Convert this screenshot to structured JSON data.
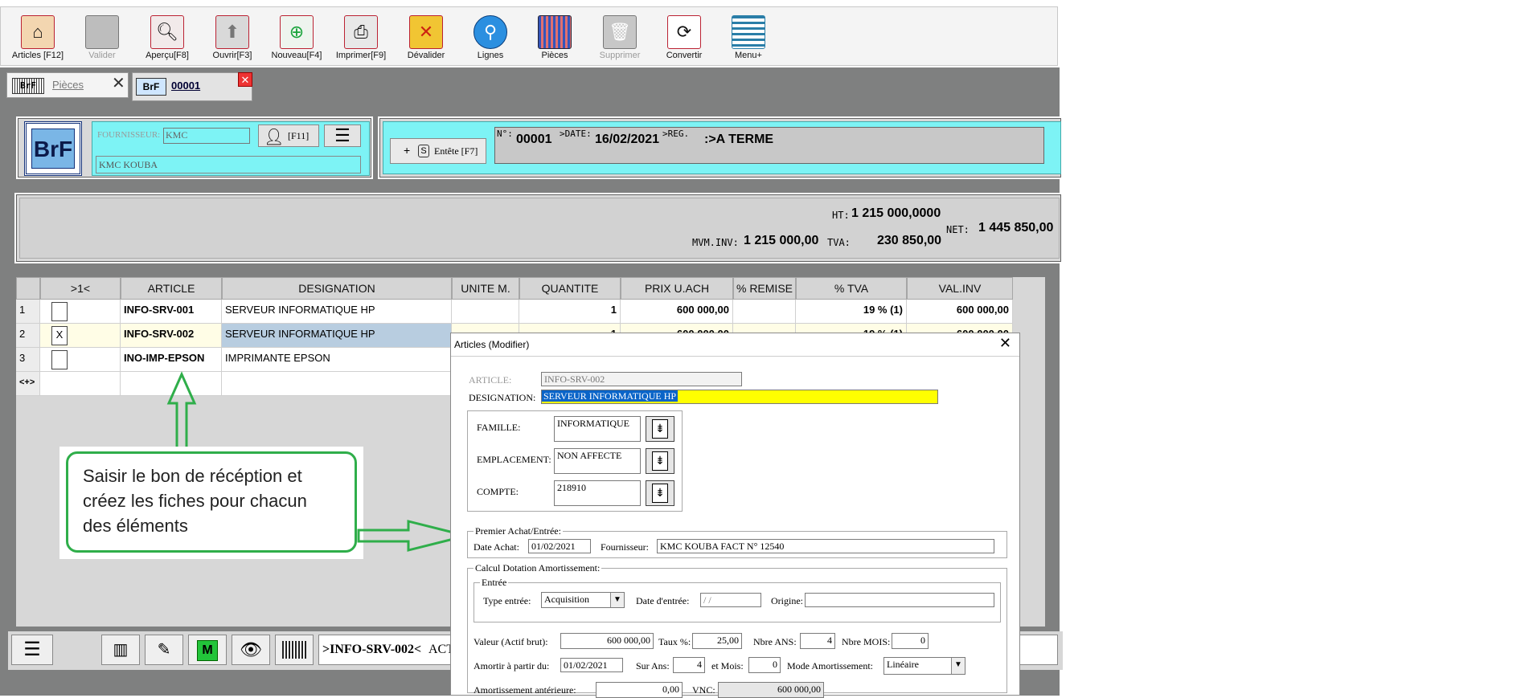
{
  "toolbar": {
    "buttons": [
      {
        "label": "Articles [F12]",
        "icon": "articles-icon",
        "enabled": true
      },
      {
        "label": "Valider",
        "icon": "validate-icon",
        "enabled": false
      },
      {
        "label": "Aperçu[F8]",
        "icon": "preview-icon",
        "enabled": true
      },
      {
        "label": "Ouvrir[F3]",
        "icon": "open-icon",
        "enabled": true
      },
      {
        "label": "Nouveau[F4]",
        "icon": "new-icon",
        "enabled": true
      },
      {
        "label": "Imprimer[F9]",
        "icon": "print-icon",
        "enabled": true
      },
      {
        "label": "Dévalider",
        "icon": "invalidate-icon",
        "enabled": true
      },
      {
        "label": "Lignes",
        "icon": "search-lines-icon",
        "enabled": true
      },
      {
        "label": "Pièces",
        "icon": "pieces-icon",
        "enabled": true
      },
      {
        "label": "Supprimer",
        "icon": "delete-icon",
        "enabled": false
      },
      {
        "label": "Convertir",
        "icon": "convert-icon",
        "enabled": true
      },
      {
        "label": "Menu+",
        "icon": "menu-icon",
        "enabled": true
      }
    ]
  },
  "tabs": {
    "pieces_label": "Pièces",
    "doc_badge": "BrF",
    "doc_number": "00001"
  },
  "header": {
    "badge": "BrF",
    "supplier_label": "FOURNISSEUR:",
    "supplier_code": "KMC",
    "supplier_name": "KMC KOUBA",
    "f11_label": "[F11]",
    "entete_label": "Entête [F7]",
    "entete_key": "S",
    "plus_sign": "+",
    "num_label": "N°:",
    "num_value": "00001",
    "date_label": ">DATE:",
    "date_value": "16/02/2021",
    "reg_label": ">REG.",
    "reg_value": ":>A TERME"
  },
  "totals": {
    "ht_label": "HT:",
    "ht_value": "1 215 000,0000",
    "mvm_label": "MVM.INV:",
    "mvm_value": "1 215 000,00",
    "tva_label": "TVA:",
    "tva_value": "230 850,00",
    "net_label": "NET:",
    "net_value": "1 445 850,00"
  },
  "grid": {
    "columns": [
      ">1<",
      "ARTICLE",
      "DESIGNATION",
      "UNITE M.",
      "QUANTITE",
      "PRIX U.ACH",
      "% REMISE",
      "% TVA",
      "VAL.INV"
    ],
    "rows": [
      {
        "num": "1",
        "check": "",
        "article": "INFO-SRV-001",
        "designation": "SERVEUR INFORMATIQUE HP",
        "unite": "",
        "quantite": "1",
        "prix": "600 000,00",
        "remise": "",
        "tva": "19 % (1)",
        "val": "600 000,00"
      },
      {
        "num": "2",
        "check": "X",
        "article": "INFO-SRV-002",
        "designation": "SERVEUR INFORMATIQUE HP",
        "unite": "",
        "quantite": "1",
        "prix": "600 000,00",
        "remise": "",
        "tva": "19 % (1)",
        "val": "600 000,00"
      },
      {
        "num": "3",
        "check": "",
        "article": "INO-IMP-EPSON",
        "designation": "IMPRIMANTE EPSON",
        "unite": "",
        "quantite": "",
        "prix": "",
        "remise": "",
        "tva": "",
        "val": ""
      }
    ],
    "add_row_label": "<+>"
  },
  "callout": {
    "text": "Saisir le bon de récéption et créez les fiches pour chacun des éléments"
  },
  "statusbar": {
    "current": ">INFO-SRV-002<",
    "extra": "ACT"
  },
  "dialog": {
    "title": "Articles  (Modifier)",
    "article_label": "ARTICLE:",
    "article_value": "INFO-SRV-002",
    "designation_label": "DESIGNATION:",
    "designation_value": "SERVEUR INFORMATIQUE HP",
    "famille_label": "FAMILLE:",
    "famille_value": "INFORMATIQUE",
    "emplacement_label": "EMPLACEMENT:",
    "emplacement_value": "NON AFFECTE",
    "compte_label": "COMPTE:",
    "compte_value": "218910",
    "premier_label": "Premier Achat/Entrée:",
    "date_achat_label": "Date Achat:",
    "date_achat_value": "01/02/2021",
    "fournisseur_label": "Fournisseur:",
    "fournisseur_value": "KMC KOUBA  FACT N° 12540",
    "calcul_label": "Calcul Dotation Amortissement:",
    "entree_label": "Entrée",
    "type_entree_label": "Type entrée:",
    "type_entree_value": "Acquisition",
    "date_entree_label": "Date d'entrée:",
    "date_entree_value": " / /",
    "origine_label": "Origine:",
    "origine_value": "",
    "valeur_label": "Valeur (Actif brut):",
    "valeur_value": "600 000,00",
    "taux_label": "Taux %:",
    "taux_value": "25,00",
    "nbre_ans_label": "Nbre ANS:",
    "nbre_ans_value": "4",
    "nbre_mois_label": "Nbre MOIS:",
    "nbre_mois_value": "0",
    "amortir_label": "Amortir à partir du:",
    "amortir_value": "01/02/2021",
    "sur_ans_label": "Sur Ans:",
    "sur_ans_value": "4",
    "et_mois_label": "et Mois:",
    "et_mois_value": "0",
    "mode_label": "Mode Amortissement:",
    "mode_value": "Linéaire",
    "anterieure_label": "Amortissement antérieure:",
    "anterieure_value": "0,00",
    "vnc_label": "VNC:",
    "vnc_value": "600 000,00",
    "close_glyph": "✕"
  },
  "colors": {
    "cyan": "#7df3f5",
    "callout_green": "#2fae4a",
    "highlight_yellow": "#ffff00",
    "selection_blue": "#0a64c8"
  }
}
